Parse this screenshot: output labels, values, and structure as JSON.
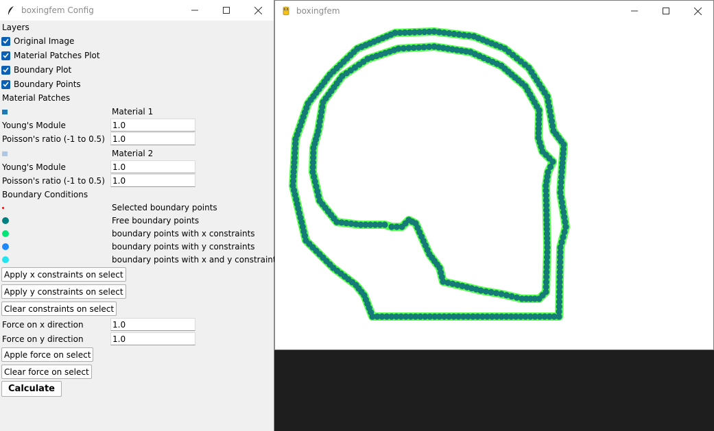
{
  "config_window": {
    "title": "boxingfem Config",
    "title_icon": "feather-icon",
    "layers_heading": "Layers",
    "layers": [
      {
        "label": "Original Image",
        "checked": true
      },
      {
        "label": "Material Patches Plot",
        "checked": true
      },
      {
        "label": "Boundary Plot",
        "checked": true
      },
      {
        "label": "Boundary Points",
        "checked": true
      }
    ],
    "patches_heading": "Material Patches",
    "materials": [
      {
        "name": "Material 1",
        "color": "#1f77b4",
        "youngs_label": "Young's Module",
        "youngs_value": "1.0",
        "poisson_label": "Poisson's ratio (-1 to 0.5)",
        "poisson_value": "1.0"
      },
      {
        "name": "Material 2",
        "color": "#aec7e8",
        "youngs_label": "Young's Module",
        "youngs_value": "1.0",
        "poisson_label": "Poisson's ratio (-1 to 0.5)",
        "poisson_value": "1.0"
      }
    ],
    "bc_heading": "Boundary Conditions",
    "legend": [
      {
        "label": "Selected boundary points",
        "color": "#ff0000"
      },
      {
        "label": "Free boundary points",
        "color": "#008080"
      },
      {
        "label": "boundary points with x constraints",
        "color": "#00e676"
      },
      {
        "label": "boundary points with y constraints",
        "color": "#1e88ff"
      },
      {
        "label": "boundary points with x and y constraints",
        "color": "#22e5f0"
      }
    ],
    "buttons": {
      "apply_x": "Apply x constraints on select",
      "apply_y": "Apply y constraints on select",
      "clear_constraints": "Clear constraints on select",
      "apply_force": "Apple force on select",
      "clear_force": "Clear force on select",
      "calculate": "Calculate"
    },
    "force_x_label": "Force on x direction",
    "force_x_value": "1.0",
    "force_y_label": "Force on y direction",
    "force_y_value": "1.0"
  },
  "plot_window": {
    "title": "boxingfem",
    "title_icon": "pygame-snake-icon",
    "outline_color": "#3cff2e",
    "point_color": "#157a78"
  }
}
